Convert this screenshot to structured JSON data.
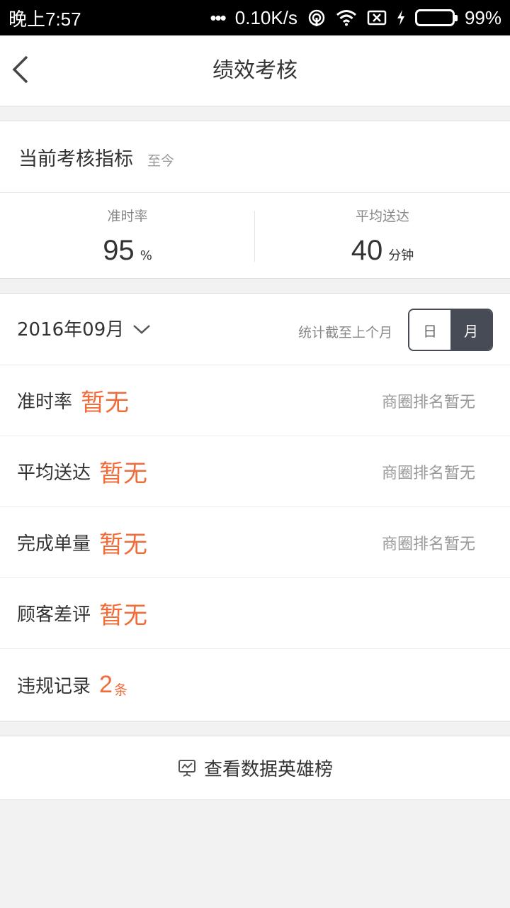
{
  "status_bar": {
    "time": "晚上7:57",
    "net_speed": "0.10K/s",
    "battery": "99%",
    "battery_level": 0.99,
    "battery_color": "#2fd14b"
  },
  "header": {
    "title": "绩效考核"
  },
  "current_metrics": {
    "title": "当前考核指标",
    "subtitle": "至今",
    "stats": [
      {
        "label": "准时率",
        "value": "95",
        "unit": "%"
      },
      {
        "label": "平均送达",
        "value": "40",
        "unit": "分钟"
      }
    ]
  },
  "monthly": {
    "month": "2016年09月",
    "note": "统计截至上个月",
    "toggle": {
      "day": "日",
      "month": "月",
      "selected": "月"
    },
    "rows": [
      {
        "label": "准时率",
        "value": "暂无",
        "rank": "商圈排名暂无"
      },
      {
        "label": "平均送达",
        "value": "暂无",
        "rank": "商圈排名暂无"
      },
      {
        "label": "完成单量",
        "value": "暂无",
        "rank": "商圈排名暂无"
      },
      {
        "label": "顾客差评",
        "value": "暂无"
      },
      {
        "label": "违规记录",
        "value": "2",
        "unit": "条"
      }
    ]
  },
  "leaderboard": {
    "label": "查看数据英雄榜",
    "icon": "chart-board-icon"
  },
  "colors": {
    "accent": "#f26c3a",
    "toggle_active": "#474b55"
  }
}
